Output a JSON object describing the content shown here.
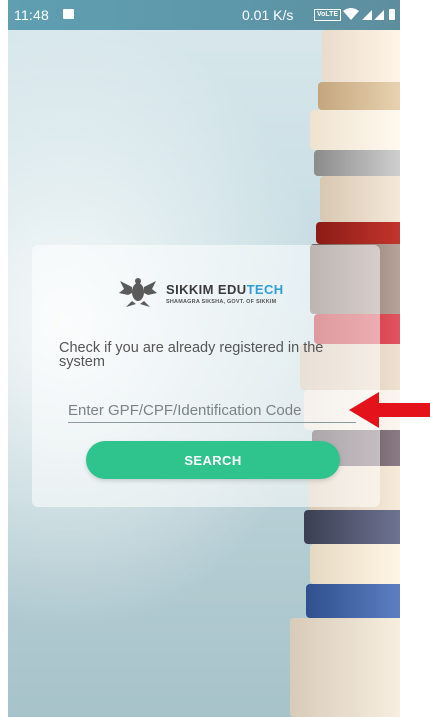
{
  "status_bar": {
    "time": "11:48",
    "net_speed": "0.01 K/s",
    "volte": "VoLTE"
  },
  "logo": {
    "title_main": "SIKKIM EDU",
    "title_accent": "TECH",
    "subtitle": "SHAMAGRA SIKSHA, GOVT. OF SIKKIM"
  },
  "card": {
    "prompt": "Check if you are already registered in the system",
    "input_placeholder": "Enter GPF/CPF/Identification Code",
    "input_value": "",
    "search_label": "SEARCH"
  },
  "colors": {
    "accent_button": "#2fc48d",
    "logo_accent": "#2e9dd9",
    "annotation_arrow": "#e3121b"
  },
  "icons": [
    "image-notification-icon",
    "wifi-icon",
    "signal-icon",
    "battery-icon",
    "emblem-icon",
    "arrow-annotation-icon"
  ]
}
